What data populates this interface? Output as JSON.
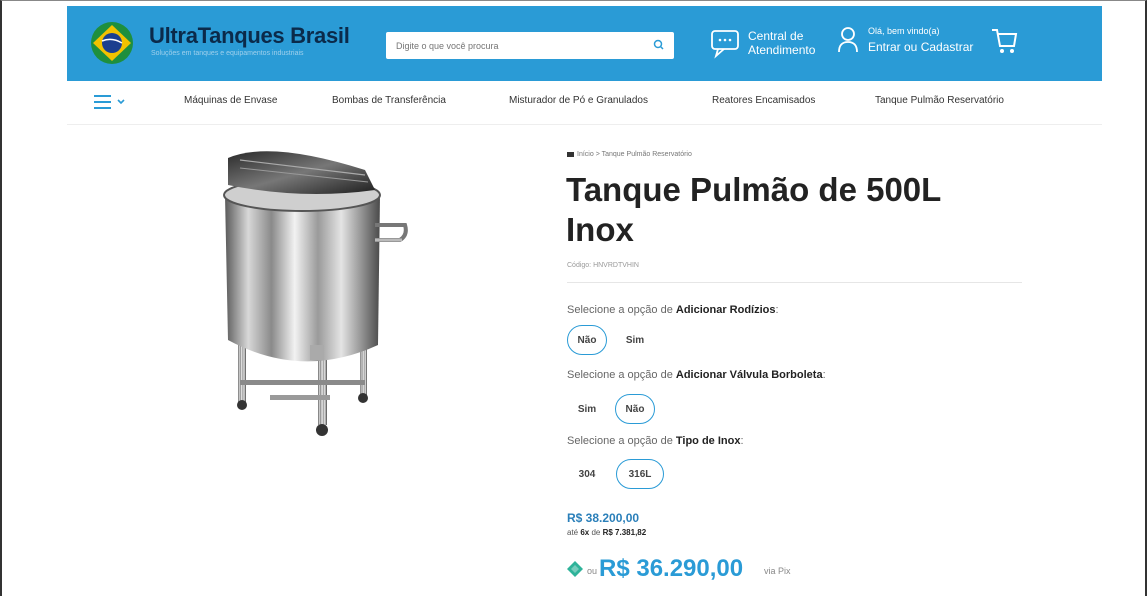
{
  "header": {
    "logo_text": "UltraTanques Brasil",
    "logo_tagline": "Soluções em tanques e equipamentos industriais",
    "search_placeholder": "Digite o que você procura",
    "support_line1": "Central de",
    "support_line2": "Atendimento",
    "greeting": "Olá, bem vindo(a)",
    "login_label": "Entrar ou Cadastrar"
  },
  "nav": {
    "items": [
      "Máquinas de Envase",
      "Bombas de Transferência",
      "Misturador de Pó e Granulados",
      "Reatores Encamisados",
      "Tanque Pulmão Reservatório"
    ]
  },
  "breadcrumb": {
    "home": "Início",
    "separator": ">",
    "current": "Tanque Pulmão Reservatório"
  },
  "product": {
    "title_line1": "Tanque Pulmão de 500L",
    "title_line2": "Inox",
    "code": "Código: HNVRDTVHIN"
  },
  "options": [
    {
      "prefix": "Selecione a opção de ",
      "name": "Adicionar Rodízios",
      "suffix": ":",
      "choices": [
        "Não",
        "Sim"
      ],
      "selected": "Não"
    },
    {
      "prefix": "Selecione a opção de ",
      "name": "Adicionar Válvula Borboleta",
      "suffix": ":",
      "choices": [
        "Sim",
        "Não"
      ],
      "selected": "Não"
    },
    {
      "prefix": "Selecione a opção de ",
      "name": "Tipo de Inox",
      "suffix": ":",
      "choices": [
        "304",
        "316L"
      ],
      "selected": "316L"
    }
  ],
  "pricing": {
    "old_price": "R$ 38.200,00",
    "inst_prefix": "até ",
    "inst_count": "6x",
    "inst_mid": " de ",
    "inst_value": "R$ 7.381,82",
    "pix_or": "ou",
    "pix_price": "R$ 36.290,00",
    "pix_via": "via Pix"
  },
  "colors": {
    "brand_blue": "#2a9bd6",
    "pix_green": "#2fb39a",
    "logo_dark": "#0b2a4a"
  },
  "icons": {
    "search": "search-icon",
    "support": "chat-icon",
    "account": "user-icon",
    "cart": "cart-icon",
    "menu": "hamburger-icon",
    "pix": "pix-icon"
  }
}
